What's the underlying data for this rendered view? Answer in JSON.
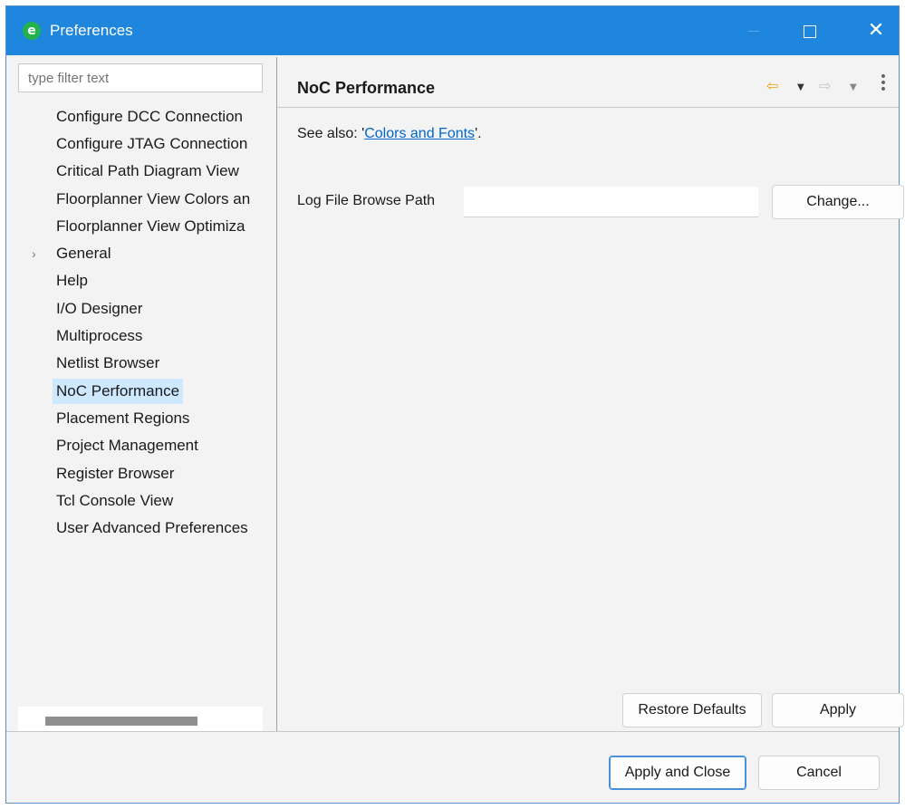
{
  "window": {
    "title": "Preferences",
    "app_icon_glyph": "ʘ",
    "minimize_glyph": "",
    "maximize_glyph": "",
    "close_glyph": "✕"
  },
  "sidebar": {
    "filter_placeholder": "type filter text",
    "items": [
      {
        "label": "Configure DCC Connection"
      },
      {
        "label": "Configure JTAG Connection"
      },
      {
        "label": "Critical Path Diagram View"
      },
      {
        "label": "Floorplanner View Colors an"
      },
      {
        "label": "Floorplanner View Optimiza"
      },
      {
        "label": "General",
        "expander": "›"
      },
      {
        "label": "Help"
      },
      {
        "label": "I/O Designer"
      },
      {
        "label": "Multiprocess"
      },
      {
        "label": "Netlist Browser"
      },
      {
        "label": "NoC Performance",
        "selected": true
      },
      {
        "label": "Placement Regions"
      },
      {
        "label": "Project Management"
      },
      {
        "label": "Register Browser"
      },
      {
        "label": "Tcl Console View"
      },
      {
        "label": "User Advanced Preferences"
      }
    ]
  },
  "page": {
    "title": "NoC Performance",
    "nav": {
      "back_glyph": "⇦",
      "forward_glyph": "⇨",
      "dropdown_glyph": "▼",
      "menu_glyph": "•••"
    },
    "see_also_prefix": "See also: '",
    "see_also_link": "Colors and Fonts",
    "see_also_suffix": "'.",
    "log_path_label": "Log File Browse Path",
    "log_path_value": "",
    "change_button": "Change...",
    "restore_defaults_button": "Restore Defaults",
    "apply_button": "Apply"
  },
  "footer": {
    "apply_close_button": "Apply and Close",
    "cancel_button": "Cancel"
  },
  "colors": {
    "titlebar": "#1e86dc",
    "selection": "#cde8ff",
    "link": "#0066cc",
    "back_arrow": "#e2a400"
  }
}
